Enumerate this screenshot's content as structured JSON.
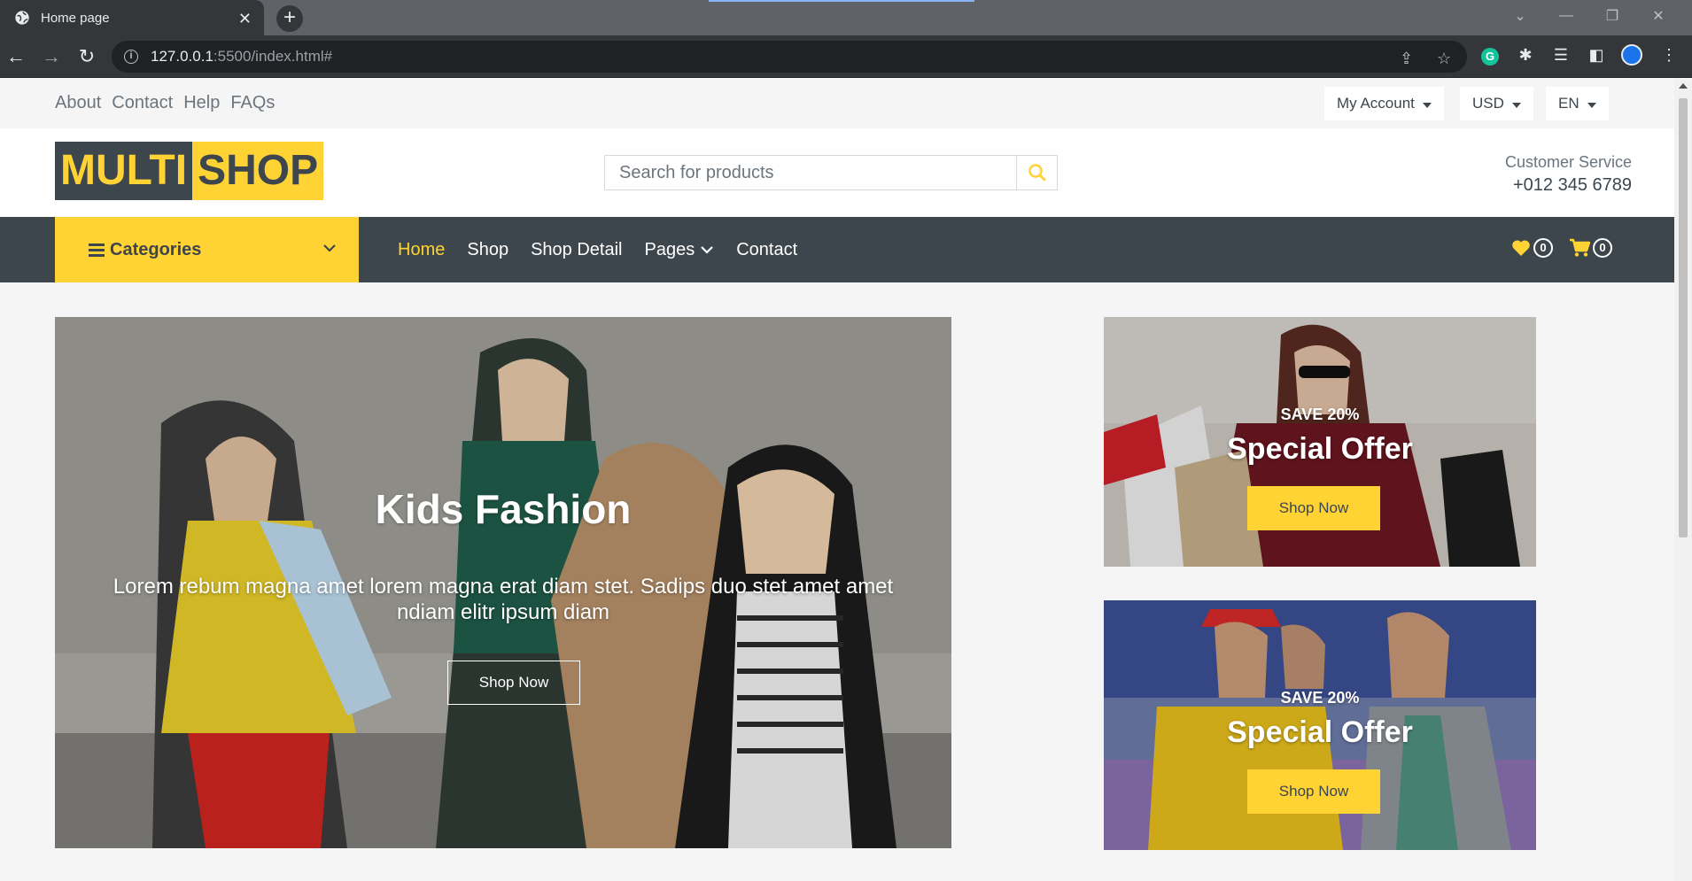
{
  "browser": {
    "tab_title": "Home page",
    "url_host": "127.0.0.1",
    "url_path": ":5500/index.html#"
  },
  "topbar": {
    "links": [
      "About",
      "Contact",
      "Help",
      "FAQs"
    ],
    "account_label": "My Account",
    "currency_label": "USD",
    "language_label": "EN"
  },
  "header": {
    "logo_part1": "MULTI",
    "logo_part2": "SHOP",
    "search_placeholder": "Search for products",
    "customer_service_label": "Customer Service",
    "customer_service_phone": "+012 345 6789"
  },
  "navbar": {
    "categories_label": "Categories",
    "links": [
      "Home",
      "Shop",
      "Shop Detail",
      "Pages",
      "Contact"
    ],
    "active_link": "Home",
    "wishlist_count": "0",
    "cart_count": "0"
  },
  "hero": {
    "title": "Kids Fashion",
    "text": "Lorem rebum magna amet lorem magna erat diam stet. Sadips duo stet amet amet ndiam elitr ipsum diam",
    "button_label": "Shop Now"
  },
  "offers": [
    {
      "save_label": "SAVE 20%",
      "title": "Special Offer",
      "button_label": "Shop Now"
    },
    {
      "save_label": "SAVE 20%",
      "title": "Special Offer",
      "button_label": "Shop Now"
    }
  ],
  "colors": {
    "accent": "#ffd333",
    "dark": "#3d464d",
    "muted": "#6c757d",
    "background": "#f5f5f5"
  }
}
